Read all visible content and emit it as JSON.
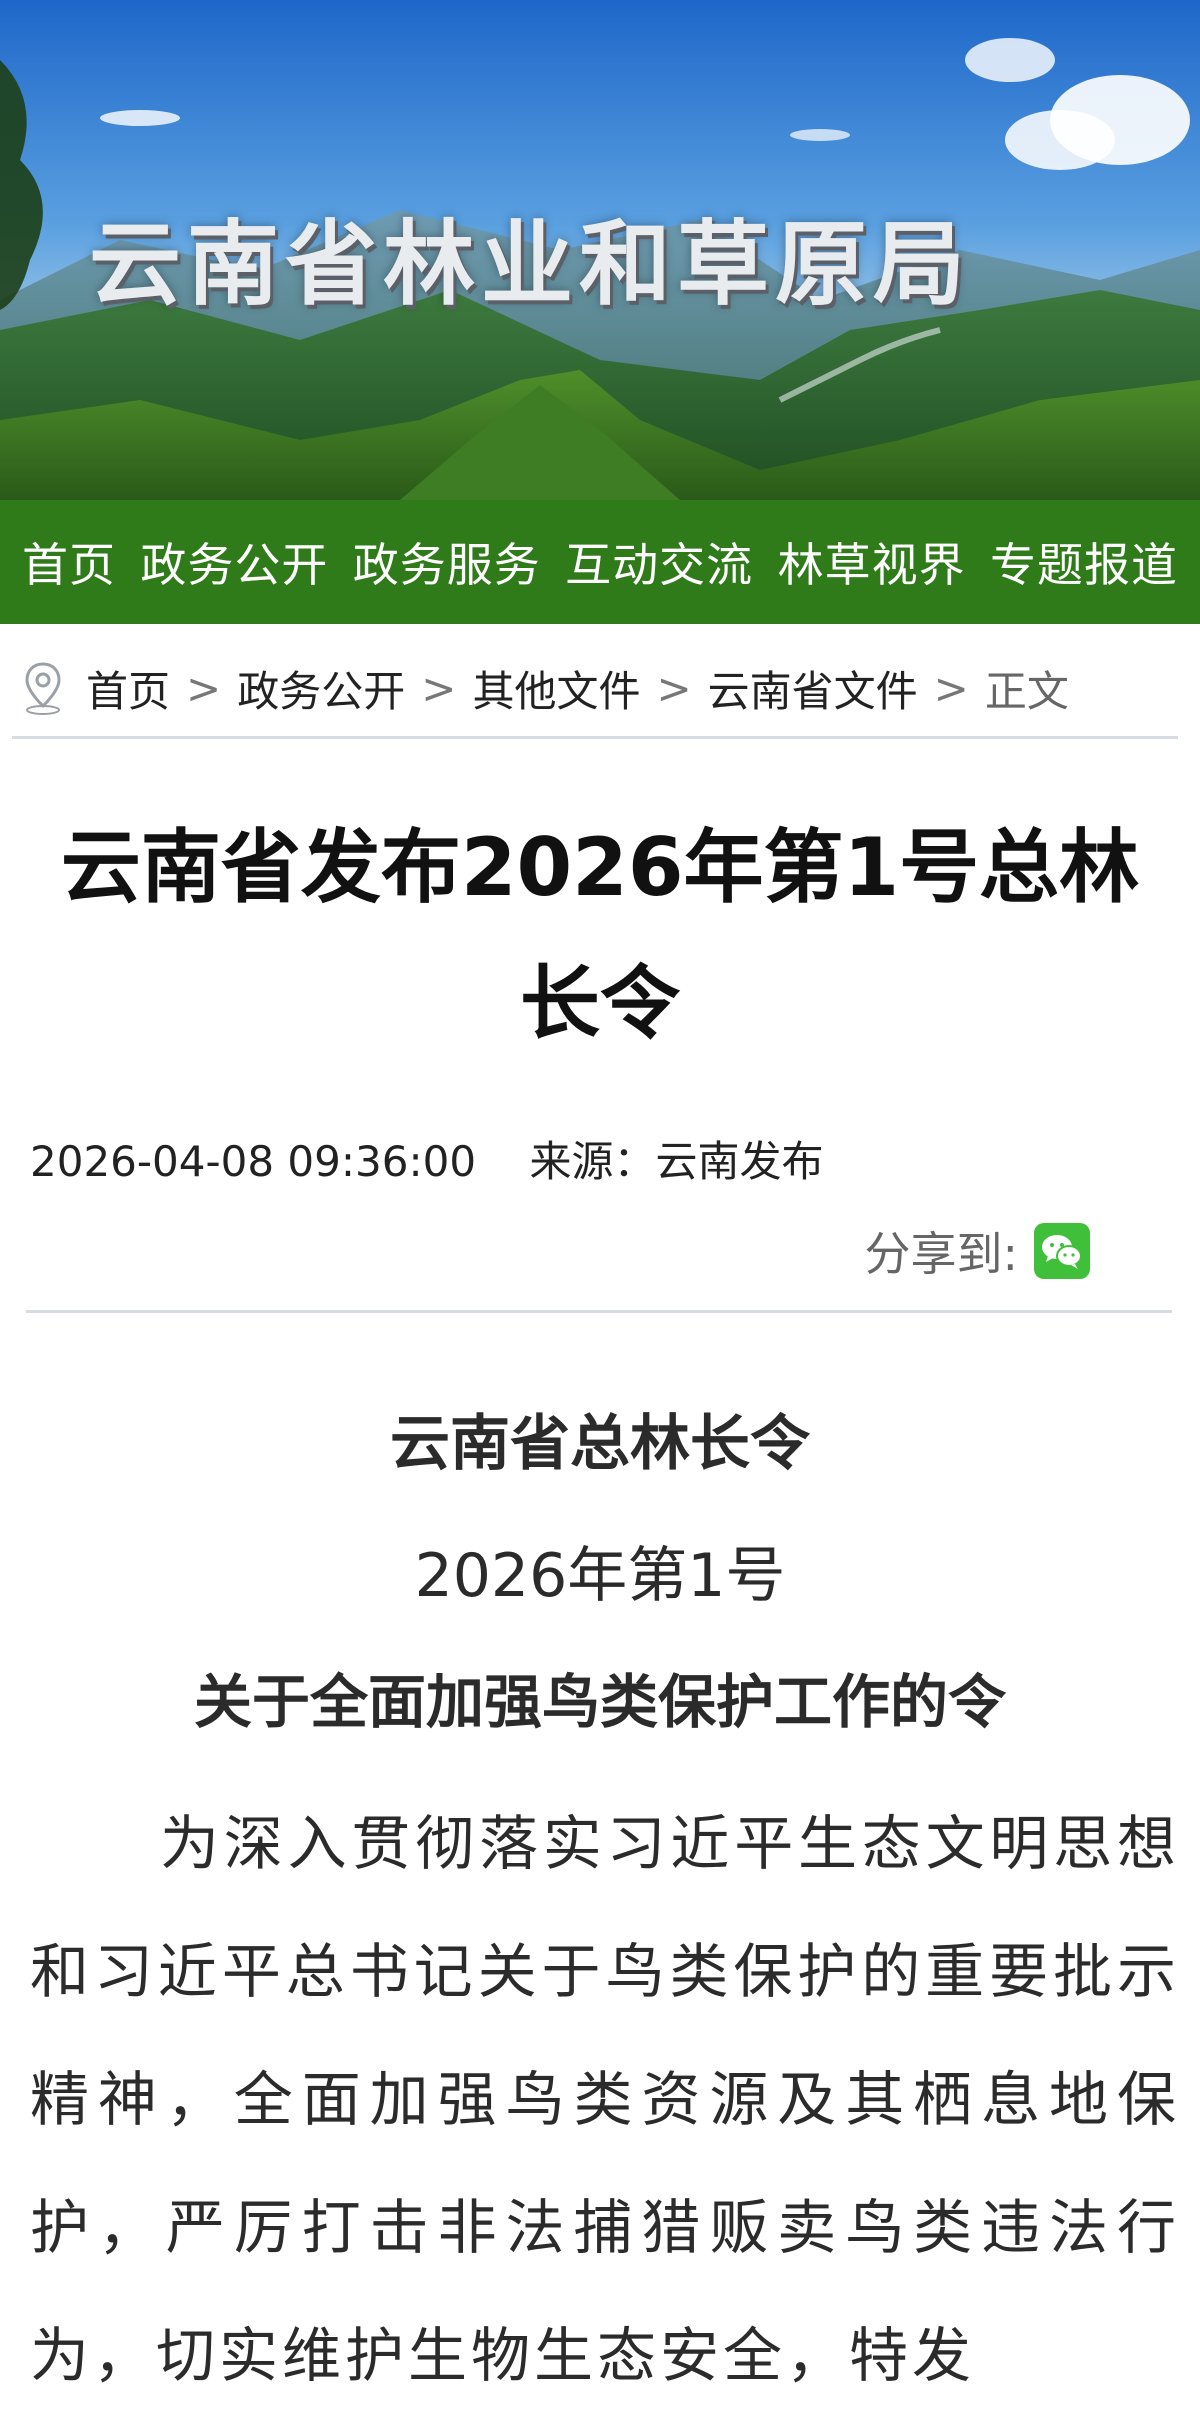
{
  "banner": {
    "site_title": "云南省林业和草原局"
  },
  "nav": {
    "items": [
      "首页",
      "政务公开",
      "政务服务",
      "互动交流",
      "林草视界",
      "专题报道"
    ]
  },
  "breadcrumb": {
    "items": [
      "首页",
      "政务公开",
      "其他文件",
      "云南省文件"
    ],
    "current": "正文",
    "separator": ">"
  },
  "article": {
    "title": "云南省发布2026年第1号总林长令",
    "datetime": "2026-04-08 09:36:00",
    "source_label": "来源：",
    "source": "云南发布",
    "share_label": "分享到:",
    "share_icon": "wechat-icon",
    "order_title": "云南省总林长令",
    "order_number": "2026年第1号",
    "order_subject": "关于全面加强鸟类保护工作的令",
    "body": "为深入贯彻落实习近平生态文明思想和习近平总书记关于鸟类保护的重要批示精神，全面加强鸟类资源及其栖息地保护，严厉打击非法捕猎贩卖鸟类违法行为，切实维护生物生态安全，特发"
  },
  "colors": {
    "nav_bg": "#2f7a19",
    "wechat_green": "#3fbf3a",
    "divider": "#d6dce1"
  }
}
